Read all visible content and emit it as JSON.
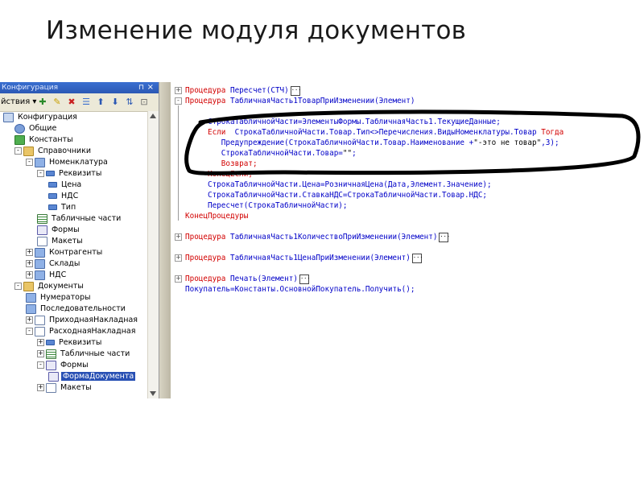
{
  "slide": {
    "title": "Изменение модуля документов"
  },
  "config_window": {
    "title": "Конфигурация",
    "actions_label": "Действия",
    "actions_visible": "йствия",
    "tree": [
      {
        "label": "Конфигурация",
        "icon": "config-icon",
        "level": 0,
        "toggle": ""
      },
      {
        "label": "Общие",
        "icon": "gear-icon",
        "level": 1,
        "toggle": ""
      },
      {
        "label": "Константы",
        "icon": "constants-icon",
        "level": 1,
        "toggle": ""
      },
      {
        "label": "Справочники",
        "icon": "folder-icon",
        "level": 1,
        "toggle": "-"
      },
      {
        "label": "Номенклатура",
        "icon": "list-icon",
        "level": 2,
        "toggle": "-"
      },
      {
        "label": "Реквизиты",
        "icon": "attributes-icon",
        "level": 3,
        "toggle": "-"
      },
      {
        "label": "Цена",
        "icon": "attribute-icon",
        "level": 4,
        "toggle": ""
      },
      {
        "label": "НДС",
        "icon": "attribute-icon",
        "level": 4,
        "toggle": ""
      },
      {
        "label": "Тип",
        "icon": "attribute-icon",
        "level": 4,
        "toggle": ""
      },
      {
        "label": "Табличные части",
        "icon": "table-icon",
        "level": 3,
        "toggle": ""
      },
      {
        "label": "Формы",
        "icon": "form-icon",
        "level": 3,
        "toggle": ""
      },
      {
        "label": "Макеты",
        "icon": "layout-icon",
        "level": 3,
        "toggle": ""
      },
      {
        "label": "Контрагенты",
        "icon": "list-icon",
        "level": 2,
        "toggle": "+"
      },
      {
        "label": "Склады",
        "icon": "list-icon",
        "level": 2,
        "toggle": "+"
      },
      {
        "label": "НДС",
        "icon": "list-icon",
        "level": 2,
        "toggle": "+"
      },
      {
        "label": "Документы",
        "icon": "folder-icon",
        "level": 1,
        "toggle": "-"
      },
      {
        "label": "Нумераторы",
        "icon": "numerator-icon",
        "level": 2,
        "toggle": ""
      },
      {
        "label": "Последовательности",
        "icon": "sequence-icon",
        "level": 2,
        "toggle": ""
      },
      {
        "label": "ПриходнаяНакладная",
        "icon": "document-icon",
        "level": 2,
        "toggle": "+"
      },
      {
        "label": "РасходнаяНакладная",
        "icon": "document-icon",
        "level": 2,
        "toggle": "-"
      },
      {
        "label": "Реквизиты",
        "icon": "attributes-icon",
        "level": 3,
        "toggle": "+"
      },
      {
        "label": "Табличные части",
        "icon": "table-icon",
        "level": 3,
        "toggle": "+"
      },
      {
        "label": "Формы",
        "icon": "form-icon",
        "level": 3,
        "toggle": "-"
      },
      {
        "label": "ФормаДокумента",
        "icon": "form-icon",
        "level": 4,
        "toggle": "",
        "selected": true
      },
      {
        "label": "Макеты",
        "icon": "layout-icon",
        "level": 3,
        "toggle": "+"
      }
    ]
  },
  "editor": {
    "lines": [
      {
        "fold": "+",
        "parts": [
          {
            "t": "Процедура ",
            "c": "kw"
          },
          {
            "t": "Пересчет(СТЧ)"
          }
        ],
        "collapsed": true
      },
      {
        "fold": "-",
        "parts": [
          {
            "t": "Процедура ",
            "c": "kw"
          },
          {
            "t": "ТабличнаяЧасть1ТоварПриИзменении(Элемент)"
          }
        ]
      },
      {
        "fold": "",
        "parts": [
          {
            "t": ""
          }
        ]
      },
      {
        "fold": "",
        "parts": [
          {
            "t": "     СтрокаТабличнойЧасти=ЭлементыФормы.ТабличнаяЧасть1.ТекущиеДанные;"
          }
        ]
      },
      {
        "fold": "",
        "parts": [
          {
            "t": "     "
          },
          {
            "t": "Если ",
            "c": "kw"
          },
          {
            "t": " СтрокаТабличнойЧасти.Товар.Тип<>Перечисления.ВидыНоменклатуры.Товар "
          },
          {
            "t": "Тогда",
            "c": "kw"
          }
        ]
      },
      {
        "fold": "",
        "parts": [
          {
            "t": "        Предупреждение(СтрокаТабличнойЧасти.Товар.Наименование +"
          },
          {
            "t": "\"-это не товар\"",
            "c": "str"
          },
          {
            "t": ",3);"
          }
        ]
      },
      {
        "fold": "",
        "parts": [
          {
            "t": "        СтрокаТабличнойЧасти.Товар="
          },
          {
            "t": "\"\"",
            "c": "str"
          },
          {
            "t": ";"
          }
        ]
      },
      {
        "fold": "",
        "parts": [
          {
            "t": "        "
          },
          {
            "t": "Возврат;",
            "c": "kw"
          }
        ]
      },
      {
        "fold": "",
        "parts": [
          {
            "t": "     "
          },
          {
            "t": "КонецЕсли;",
            "c": "kw"
          }
        ]
      },
      {
        "fold": "",
        "parts": [
          {
            "t": "     СтрокаТабличнойЧасти.Цена=РозничнаяЦена(Дата,Элемент.Значение);"
          }
        ]
      },
      {
        "fold": "",
        "parts": [
          {
            "t": "     СтрокаТабличнойЧасти.СтавкаНДС=СтрокаТабличнойЧасти.Товар.НДС;"
          }
        ]
      },
      {
        "fold": "",
        "parts": [
          {
            "t": "     Пересчет(СтрокаТабличнойЧасти);"
          }
        ]
      },
      {
        "fold": "",
        "parts": [
          {
            "t": "КонецПроцедуры",
            "c": "kw"
          }
        ]
      },
      {
        "fold": "",
        "parts": [
          {
            "t": ""
          }
        ]
      },
      {
        "fold": "+",
        "parts": [
          {
            "t": "Процедура ",
            "c": "kw"
          },
          {
            "t": "ТабличнаяЧасть1КоличествоПриИзменении(Элемент)"
          }
        ],
        "collapsed": true
      },
      {
        "fold": "",
        "parts": [
          {
            "t": ""
          }
        ]
      },
      {
        "fold": "+",
        "parts": [
          {
            "t": "Процедура ",
            "c": "kw"
          },
          {
            "t": "ТабличнаяЧасть1ЦенаПриИзменении(Элемент)"
          }
        ],
        "collapsed": true
      },
      {
        "fold": "",
        "parts": [
          {
            "t": ""
          }
        ]
      },
      {
        "fold": "+",
        "parts": [
          {
            "t": "Процедура ",
            "c": "kw"
          },
          {
            "t": "Печать(Элемент)"
          }
        ],
        "collapsed": true
      },
      {
        "fold": "",
        "parts": [
          {
            "t": "Покупатель=Константы.ОсновнойПокупатель.Получить();"
          }
        ]
      }
    ]
  }
}
